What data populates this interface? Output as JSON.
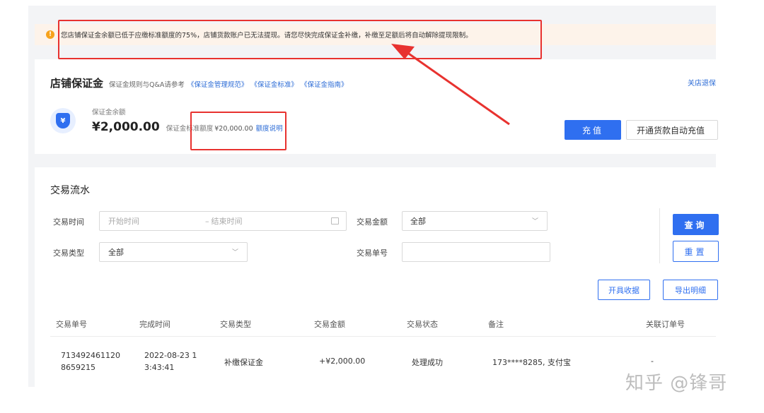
{
  "alert": {
    "message": "您店铺保证金余额已低于应缴标准额度的75%，店铺货款账户已无法提现。请您尽快完成保证金补缴，补缴至足额后将自动解除提现限制。"
  },
  "deposit": {
    "title": "店铺保证金",
    "rules_text": "保证金规则与Q&A请参考",
    "links": [
      "《保证金管理规范》",
      "《保证金标准》",
      "《保证金指南》"
    ],
    "close_link": "关店退保",
    "balance_label": "保证金余额",
    "balance_amount": "¥2,000.00",
    "standard_label": "保证金标准额度",
    "standard_value": "¥20,000.00",
    "quota_link": "额度说明",
    "recharge_button": "充值",
    "auto_recharge_button": "开通货款自动充值"
  },
  "transactions": {
    "title": "交易流水",
    "filters": {
      "time_label": "交易时间",
      "start_placeholder": "开始时间",
      "range_sep": "–",
      "end_placeholder": "结束时间",
      "amount_label": "交易金额",
      "amount_value": "全部",
      "type_label": "交易类型",
      "type_value": "全部",
      "order_label": "交易单号",
      "order_value": ""
    },
    "query_button": "查询",
    "reset_button": "重置",
    "receipt_button": "开具收据",
    "export_button": "导出明细",
    "columns": [
      "交易单号",
      "完成时间",
      "交易类型",
      "交易金额",
      "交易状态",
      "备注",
      "关联订单号"
    ],
    "rows": [
      {
        "id_line1": "713492461120",
        "id_line2": "8659215",
        "time_line1": "2022-08-23 1",
        "time_line2": "3:43:41",
        "type": "补缴保证金",
        "amount": "+¥2,000.00",
        "status": "处理成功",
        "note": "173****8285, 支付宝",
        "related": "-"
      }
    ]
  },
  "watermark": "知乎 @锋哥",
  "colors": {
    "accent": "#2f6ff0",
    "link": "#2b6bd6",
    "alert_bg": "#fdf3ea",
    "alert_icon": "#f7a21b",
    "annotation_red": "#e8322f"
  }
}
